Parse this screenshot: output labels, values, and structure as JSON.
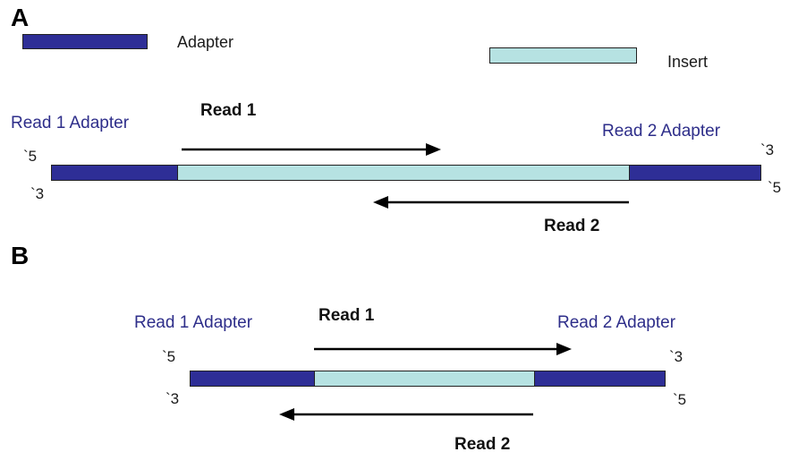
{
  "colors": {
    "adapter": "#2e2e96",
    "insert": "#b6e2e2",
    "adapter_label": "#2e2e8a",
    "arrow": "#000000"
  },
  "legend": {
    "adapter_label": "Adapter",
    "insert_label": "Insert"
  },
  "panels": [
    {
      "label": "A",
      "read1_adapter_label": "Read 1 Adapter",
      "read2_adapter_label": "Read 2 Adapter",
      "read1_label": "Read 1",
      "read2_label": "Read 2",
      "top_left_end": "`5",
      "bottom_left_end": "`3",
      "top_right_end": "`3",
      "bottom_right_end": "`5"
    },
    {
      "label": "B",
      "read1_adapter_label": "Read 1 Adapter",
      "read2_adapter_label": "Read 2 Adapter",
      "read1_label": "Read 1",
      "read2_label": "Read 2",
      "top_left_end": "`5",
      "bottom_left_end": "`3",
      "top_right_end": "`3",
      "bottom_right_end": "`5"
    }
  ]
}
